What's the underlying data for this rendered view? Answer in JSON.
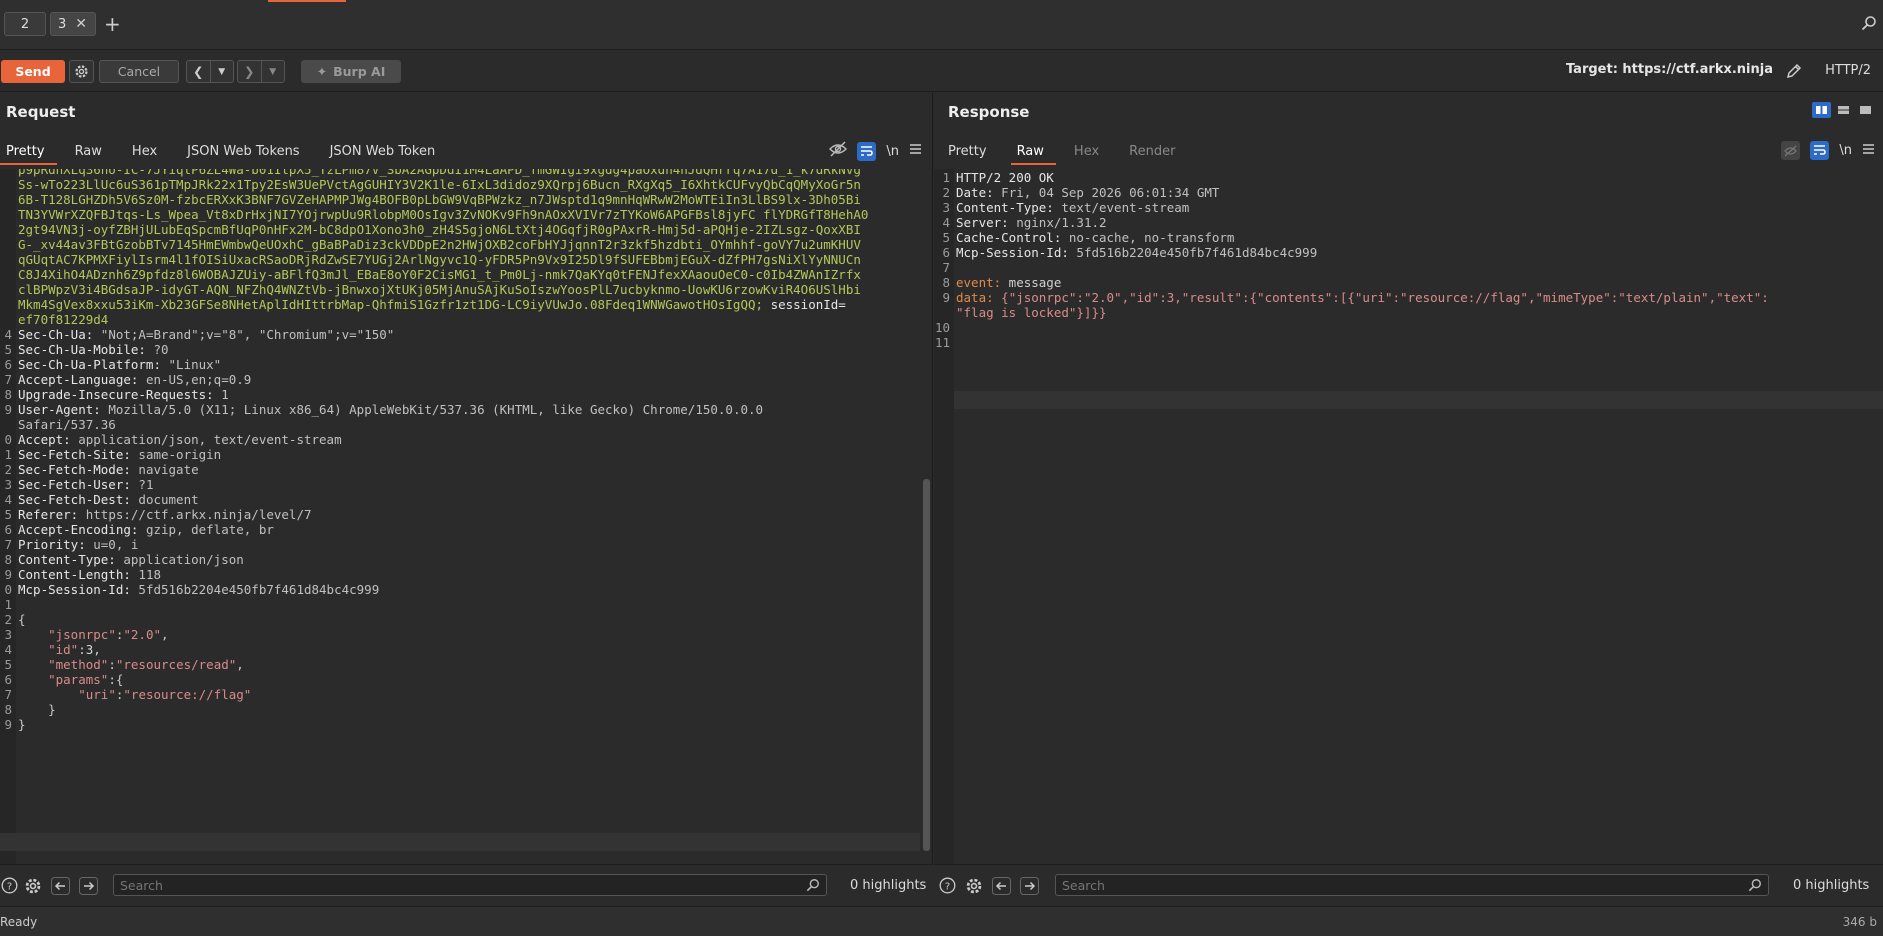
{
  "tabs": [
    {
      "label": "2"
    },
    {
      "label": "3"
    }
  ],
  "toolbar": {
    "send_label": "Send",
    "cancel_label": "Cancel",
    "burp_ai_label": "Burp AI",
    "target_label": "Target: https://ctf.arkx.ninja",
    "http_version": "HTTP/2"
  },
  "request": {
    "title": "Request",
    "tabs": [
      "Pretty",
      "Raw",
      "Hex",
      "JSON Web Tokens",
      "JSON Web Token"
    ],
    "active_tab": "Pretty",
    "newline_label": "\\n",
    "cookie_lines": [
      "p9pRdnXLq36nU-IC-7JYiqtP6ZL4Wa-b01ItpX5_TzLPm87V_SbA2AGpDdI1M4LaAPD_fmGWIgi9xgdg4paOxdh4hJdQHrrq7A17d_1_k7dRkNvg",
      "Ss-wTo223LlUc6uS361pTMpJRk22x1Tpy2EsW3UePVctAgGUHIY3V2K1le-6IxL3didoz9XQrpj6Bucn_RXgXq5_I6XhtkCUFvyQbCqQMyXoGr5n",
      "6B-T128LGHZDh5V6Sz0M-fzbcERXxK3BNF7GVZeHAPMPJWg4BOFB0pLbGW9VqBPWzkz_n7JWsptd1q9mnHqWRwW2MoWTEiIn3LlBS9lx-3Dh05Bi",
      "TN3YVWrXZQFBJtqs-Ls_Wpea_Vt8xDrHxjNI7YOjrwpUu9RlobpM0OsIgv3ZvNOKv9Fh9nAOxXVIVr7zTYKoW6APGFBsl8jyFC flYDRGfT8HehA0",
      "2gt94VN3j-oyfZBHjULubEqSpcmBfUqP0nHFx2M-bC8dpO1Xono3h0_zH4S5gjoN6LtXtj4OGqfjR0gPAxrR-Hmj5d-aPQHje-2IZLsgz-QoxXBI",
      "G-_xv44av3FBtGzobBTv7145HmEWmbwQeUOxhC_gBaBPaDiz3ckVDDpE2n2HWjOXB2coFbHYJjqnnT2r3zkf5hzdbti_OYmhhf-goVY7u2umKHUV",
      "qGUqtAC7KPMXFiylIsrm4l1fOISiUxacRSaoDRjRdZwSE7YUGj2ArlNgyvc1Q-yFDR5Pn9Vx9I25Dl9fSUFEBbmjEGuX-dZfPH7gsNiXlYyNNUCn",
      "C8J4XihO4ADznh6Z9pfdz8l6WOBAJZUiy-aBFlfQ3mJl_EBaE8oY0F2CisMG1_t_Pm0Lj-nmk7QaKYq0tFENJfexXAaouOeC0-c0Ib4ZWAnIZrfx",
      "clBPWpzV3i4BGdsaJP-idyGT-AQN_NFZhQ4WNZtVb-jBnwxojXtUKj05MjAnuSAjKuSoIszwYoosPlL7ucbyknmo-UowKU6rzowKviR4O6USlHbi",
      "Mkm4SgVex8xxu53iKm-Xb23GFSe8NHetAplIdHIttrbMap-QhfmiS1Gzfr1zt1DG-LC9iyVUwJo.08Fdeq1WNWGawotHOsIgQQ;",
      "ef70f81229d4"
    ],
    "session_key": " sessionId=",
    "headers": [
      {
        "n": "4",
        "name": "Sec-Ch-Ua:",
        "value": " \"Not;A=Brand\";v=\"8\", \"Chromium\";v=\"150\""
      },
      {
        "n": "5",
        "name": "Sec-Ch-Ua-Mobile:",
        "value": " ?0"
      },
      {
        "n": "6",
        "name": "Sec-Ch-Ua-Platform:",
        "value": " \"Linux\""
      },
      {
        "n": "7",
        "name": "Accept-Language:",
        "value": " en-US,en;q=0.9"
      },
      {
        "n": "8",
        "name": "Upgrade-Insecure-Requests:",
        "value": " 1"
      },
      {
        "n": "9",
        "name": "User-Agent:",
        "value": " Mozilla/5.0 (X11; Linux x86_64) AppleWebKit/537.36 (KHTML, like Gecko) Chrome/150.0.0.0"
      },
      {
        "n": "",
        "name": "",
        "value": "Safari/537.36"
      },
      {
        "n": "0",
        "name": "Accept:",
        "value": " application/json, text/event-stream"
      },
      {
        "n": "1",
        "name": "Sec-Fetch-Site:",
        "value": " same-origin"
      },
      {
        "n": "2",
        "name": "Sec-Fetch-Mode:",
        "value": " navigate"
      },
      {
        "n": "3",
        "name": "Sec-Fetch-User:",
        "value": " ?1"
      },
      {
        "n": "4",
        "name": "Sec-Fetch-Dest:",
        "value": " document"
      },
      {
        "n": "5",
        "name": "Referer:",
        "value": " https://ctf.arkx.ninja/level/7"
      },
      {
        "n": "6",
        "name": "Accept-Encoding:",
        "value": " gzip, deflate, br"
      },
      {
        "n": "7",
        "name": "Priority:",
        "value": " u=0, i"
      },
      {
        "n": "8",
        "name": "Content-Type:",
        "value": " application/json"
      },
      {
        "n": "9",
        "name": "Content-Length:",
        "value": " 118"
      },
      {
        "n": "0",
        "name": "Mcp-Session-Id:",
        "value": " 5fd516b2204e450fb7f461d84bc4c999"
      }
    ],
    "body": [
      {
        "n": "1",
        "text": ""
      },
      {
        "n": "2",
        "text": "{"
      },
      {
        "n": "3",
        "key": "\"jsonrpc\"",
        "val": "\"2.0\"",
        "indent": "    ",
        "tail": ","
      },
      {
        "n": "4",
        "key": "\"id\"",
        "num": "3",
        "indent": "    ",
        "tail": ","
      },
      {
        "n": "5",
        "key": "\"method\"",
        "val": "\"resources/read\"",
        "indent": "    ",
        "tail": ","
      },
      {
        "n": "6",
        "key": "\"params\"",
        "open": "{",
        "indent": "    ",
        "tail": ""
      },
      {
        "n": "7",
        "key": "\"uri\"",
        "val": "\"resource://flag\"",
        "indent": "        ",
        "tail": ""
      },
      {
        "n": "8",
        "text": "    }"
      },
      {
        "n": "9",
        "text": "}"
      }
    ],
    "search_placeholder": "Search",
    "highlights": "0 highlights"
  },
  "response": {
    "title": "Response",
    "tabs": [
      "Pretty",
      "Raw",
      "Hex",
      "Render"
    ],
    "active_tab": "Raw",
    "newline_label": "\\n",
    "lines": [
      {
        "n": "1",
        "name": "HTTP/2 200 OK",
        "value": ""
      },
      {
        "n": "2",
        "name": "Date:",
        "value": " Fri, 04 Sep 2026 06:01:34 GMT"
      },
      {
        "n": "3",
        "name": "Content-Type:",
        "value": " text/event-stream"
      },
      {
        "n": "4",
        "name": "Server:",
        "value": " nginx/1.31.2"
      },
      {
        "n": "5",
        "name": "Cache-Control:",
        "value": " no-cache, no-transform"
      },
      {
        "n": "6",
        "name": "Mcp-Session-Id:",
        "value": " 5fd516b2204e450fb7f461d84bc4c999"
      },
      {
        "n": "7",
        "name": "",
        "value": ""
      },
      {
        "n": "8",
        "name": "event:",
        "value": " message"
      }
    ],
    "data_key": "data:",
    "data_line1": " {\"jsonrpc\":\"2.0\",\"id\":3,\"result\":{\"contents\":[{\"uri\":\"resource://flag\",\"mimeType\":\"text/plain\",\"text\":",
    "data_line2": "\"flag is locked\"}]}}",
    "extra_lines": [
      "10",
      "11"
    ],
    "search_placeholder": "Search",
    "highlights": "0 highlights"
  },
  "status": {
    "text": "Ready",
    "size": "346 b"
  }
}
